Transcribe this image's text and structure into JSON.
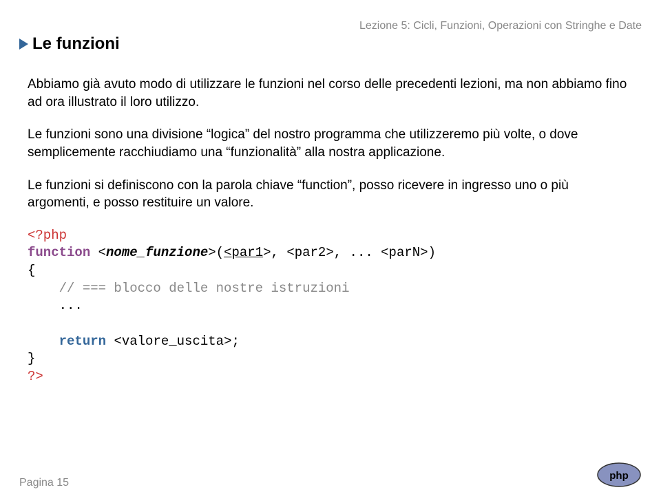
{
  "header": "Lezione 5: Cicli, Funzioni, Operazioni con Stringhe e Date",
  "section_title": "Le funzioni",
  "para1": "Abbiamo già avuto modo di utilizzare le funzioni nel corso delle precedenti lezioni, ma non abbiamo fino ad ora illustrato il loro utilizzo.",
  "para2": "Le funzioni sono una divisione “logica” del nostro programma che utilizzeremo più volte, o dove semplicemente racchiudiamo una “funzionalità” alla nostra applicazione.",
  "para3": "Le funzioni si definiscono con la parola chiave “function”, posso ricevere in ingresso uno o più argomenti, e posso restituire un valore.",
  "code": {
    "open_tag": "<?php",
    "kw_function": "function",
    "fn_name": "nome_funzione",
    "par1": "par1",
    "par2": "<par2>",
    "parN": "<parN>",
    "brace_open": "{",
    "comment": "// === blocco delle nostre istruzioni",
    "ellipsis": "...",
    "kw_return": "return",
    "ret_val": "<valore_uscita>",
    "brace_close": "}",
    "close_tag": "?>"
  },
  "page_label": "Pagina 15"
}
